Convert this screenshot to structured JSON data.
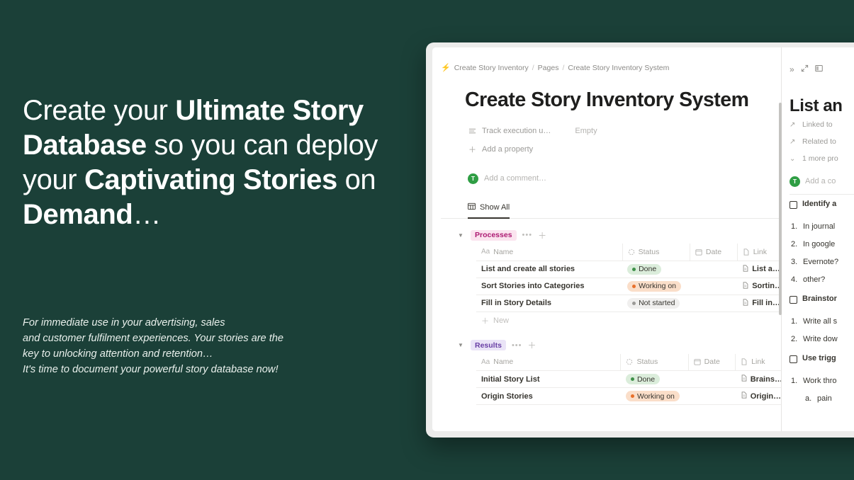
{
  "marketing": {
    "headline_parts": [
      {
        "text": "Create your ",
        "bold": false
      },
      {
        "text": "Ultimate Story Database",
        "bold": true
      },
      {
        "text": " so you can deploy your ",
        "bold": false
      },
      {
        "text": "Captivating Stories",
        "bold": true
      },
      {
        "text": " on ",
        "bold": false
      },
      {
        "text": "Demand",
        "bold": true
      },
      {
        "text": "…",
        "bold": false
      }
    ],
    "subcopy_lines": [
      "For immediate use in your advertising, sales",
      "and customer fulfilment experiences. Your stories are the",
      "key to unlocking attention and retention…",
      "It's time to document your powerful story database now!"
    ],
    "background_color": "#1b4038",
    "text_color": "#ffffff"
  },
  "app": {
    "breadcrumb": {
      "icon": "lightning-bolt-icon",
      "items": [
        "Create Story Inventory",
        "Pages",
        "Create Story Inventory System"
      ],
      "separator": "/"
    },
    "page_title": "Create Story Inventory System",
    "properties": [
      {
        "icon": "text-property-icon",
        "label": "Track execution u…",
        "value": "Empty"
      },
      {
        "icon": "plus-icon",
        "label": "Add a property",
        "value": ""
      }
    ],
    "comment": {
      "avatar_initial": "T",
      "avatar_color": "#2f9e44",
      "placeholder": "Add a comment…"
    },
    "tab": {
      "icon": "table-icon",
      "label": "Show All"
    },
    "databases": [
      {
        "tag": "Processes",
        "tag_style": "pink",
        "columns": [
          {
            "icon": "Aa",
            "label": "Name"
          },
          {
            "icon": "status-icon",
            "label": "Status"
          },
          {
            "icon": "calendar-icon",
            "label": "Date"
          },
          {
            "icon": "file-icon",
            "label": "Link"
          }
        ],
        "rows": [
          {
            "name": "List and create all stories",
            "status": "Done",
            "status_style": "done",
            "date": "",
            "link": "List a…"
          },
          {
            "name": "Sort Stories into Categories",
            "status": "Working on",
            "status_style": "working",
            "date": "",
            "link": "Sortin…"
          },
          {
            "name": "Fill in Story Details",
            "status": "Not started",
            "status_style": "notstarted",
            "date": "",
            "link": "Fill in…"
          }
        ],
        "new_row_label": "New"
      },
      {
        "tag": "Results",
        "tag_style": "purple",
        "columns": [
          {
            "icon": "Aa",
            "label": "Name"
          },
          {
            "icon": "status-icon",
            "label": "Status"
          },
          {
            "icon": "calendar-icon",
            "label": "Date"
          },
          {
            "icon": "file-icon",
            "label": "Link"
          }
        ],
        "rows": [
          {
            "name": "Initial Story List",
            "status": "Done",
            "status_style": "done",
            "date": "",
            "link": "Brains…"
          },
          {
            "name": "Origin Stories",
            "status": "Working on",
            "status_style": "working",
            "date": "",
            "link": "Origin…"
          }
        ],
        "new_row_label": ""
      }
    ],
    "side_panel": {
      "icons": [
        "double-chevron-right-icon",
        "expand-arrows-icon",
        "panel-layout-icon"
      ],
      "title": "List an",
      "properties": [
        {
          "icon": "arrow-up-right-icon",
          "label": "Linked to"
        },
        {
          "icon": "arrow-up-right-icon",
          "label": "Related to"
        },
        {
          "icon": "chevron-down-icon",
          "label": "1 more pro"
        }
      ],
      "comment": {
        "avatar_initial": "T",
        "placeholder": "Add a co"
      },
      "blocks": [
        {
          "type": "todo",
          "text": "Identify a"
        },
        {
          "type": "numbered",
          "number": "1.",
          "text": "In journal"
        },
        {
          "type": "numbered",
          "number": "2.",
          "text": "In google"
        },
        {
          "type": "numbered",
          "number": "3.",
          "text": "Evernote?"
        },
        {
          "type": "numbered",
          "number": "4.",
          "text": "other?"
        },
        {
          "type": "spacer",
          "text": ""
        },
        {
          "type": "todo",
          "text": "Brainstor"
        },
        {
          "type": "numbered",
          "number": "1.",
          "text": "Write all s"
        },
        {
          "type": "numbered",
          "number": "2.",
          "text": "Write dow"
        },
        {
          "type": "spacer",
          "text": ""
        },
        {
          "type": "todo",
          "text": "Use trigg"
        },
        {
          "type": "numbered",
          "number": "1.",
          "text": "Work thro"
        },
        {
          "type": "sub",
          "number": "a.",
          "text": "pain"
        }
      ]
    }
  }
}
